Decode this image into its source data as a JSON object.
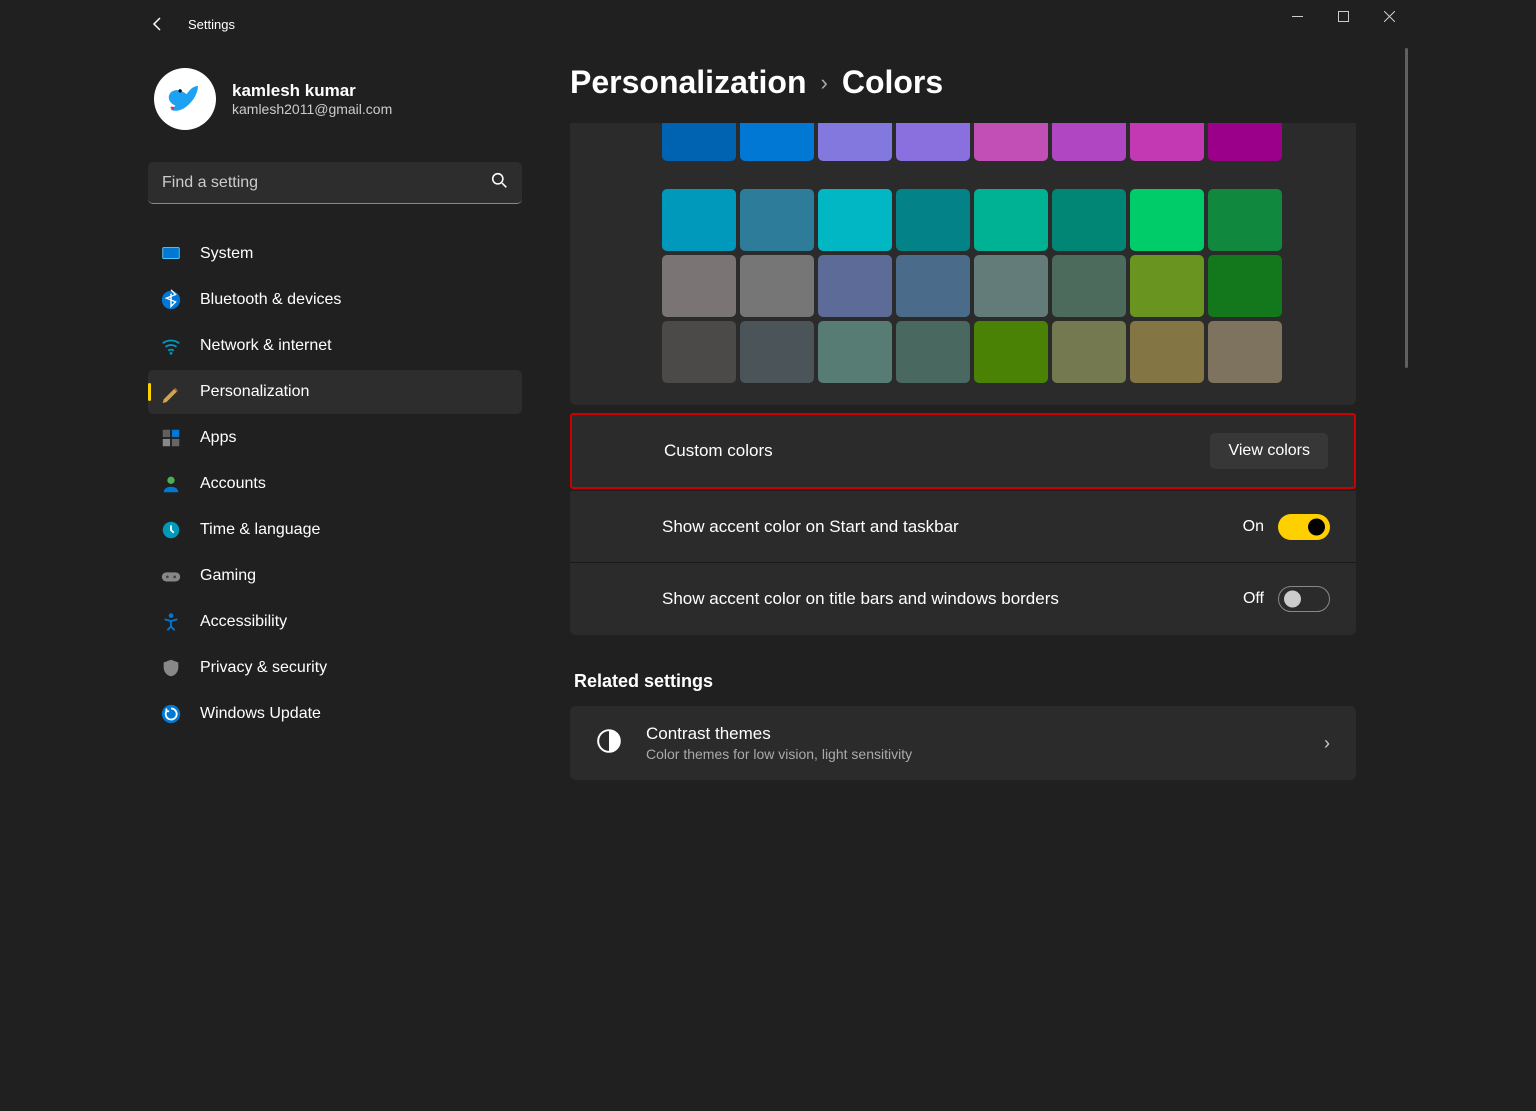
{
  "app_title": "Settings",
  "user": {
    "name": "kamlesh kumar",
    "email": "kamlesh2011@gmail.com"
  },
  "search": {
    "placeholder": "Find a setting"
  },
  "nav": [
    {
      "id": "system",
      "label": "System"
    },
    {
      "id": "bluetooth",
      "label": "Bluetooth & devices"
    },
    {
      "id": "network",
      "label": "Network & internet"
    },
    {
      "id": "personalization",
      "label": "Personalization"
    },
    {
      "id": "apps",
      "label": "Apps"
    },
    {
      "id": "accounts",
      "label": "Accounts"
    },
    {
      "id": "time",
      "label": "Time & language"
    },
    {
      "id": "gaming",
      "label": "Gaming"
    },
    {
      "id": "accessibility",
      "label": "Accessibility"
    },
    {
      "id": "privacy",
      "label": "Privacy & security"
    },
    {
      "id": "update",
      "label": "Windows Update"
    }
  ],
  "breadcrumb": {
    "parent": "Personalization",
    "current": "Colors"
  },
  "color_rows": [
    [
      "#0063b1",
      "#0078d4",
      "#8378de",
      "#8a6fdf",
      "#c24fb5",
      "#b146c2",
      "#c239b3",
      "#9a0089"
    ],
    [
      "#0099bc",
      "#2d7d9a",
      "#00b7c3",
      "#038387",
      "#00b294",
      "#018574",
      "#00cc6a",
      "#10893e"
    ],
    [
      "#7a7574",
      "#767676",
      "#5d6b99",
      "#4a6b8a",
      "#647c79",
      "#4c6b5c",
      "#68941f",
      "#13771b"
    ],
    [
      "#4c4a48",
      "#4a5459",
      "#567c73",
      "#486860",
      "#498205",
      "#74794f",
      "#847545",
      "#7e735f"
    ]
  ],
  "custom": {
    "label": "Custom colors",
    "button": "View colors"
  },
  "accent_taskbar": {
    "label": "Show accent color on Start and taskbar",
    "state": "On",
    "on": true
  },
  "accent_titlebar": {
    "label": "Show accent color on title bars and windows borders",
    "state": "Off",
    "on": false
  },
  "related": {
    "header": "Related settings",
    "contrast": {
      "title": "Contrast themes",
      "sub": "Color themes for low vision, light sensitivity"
    }
  }
}
